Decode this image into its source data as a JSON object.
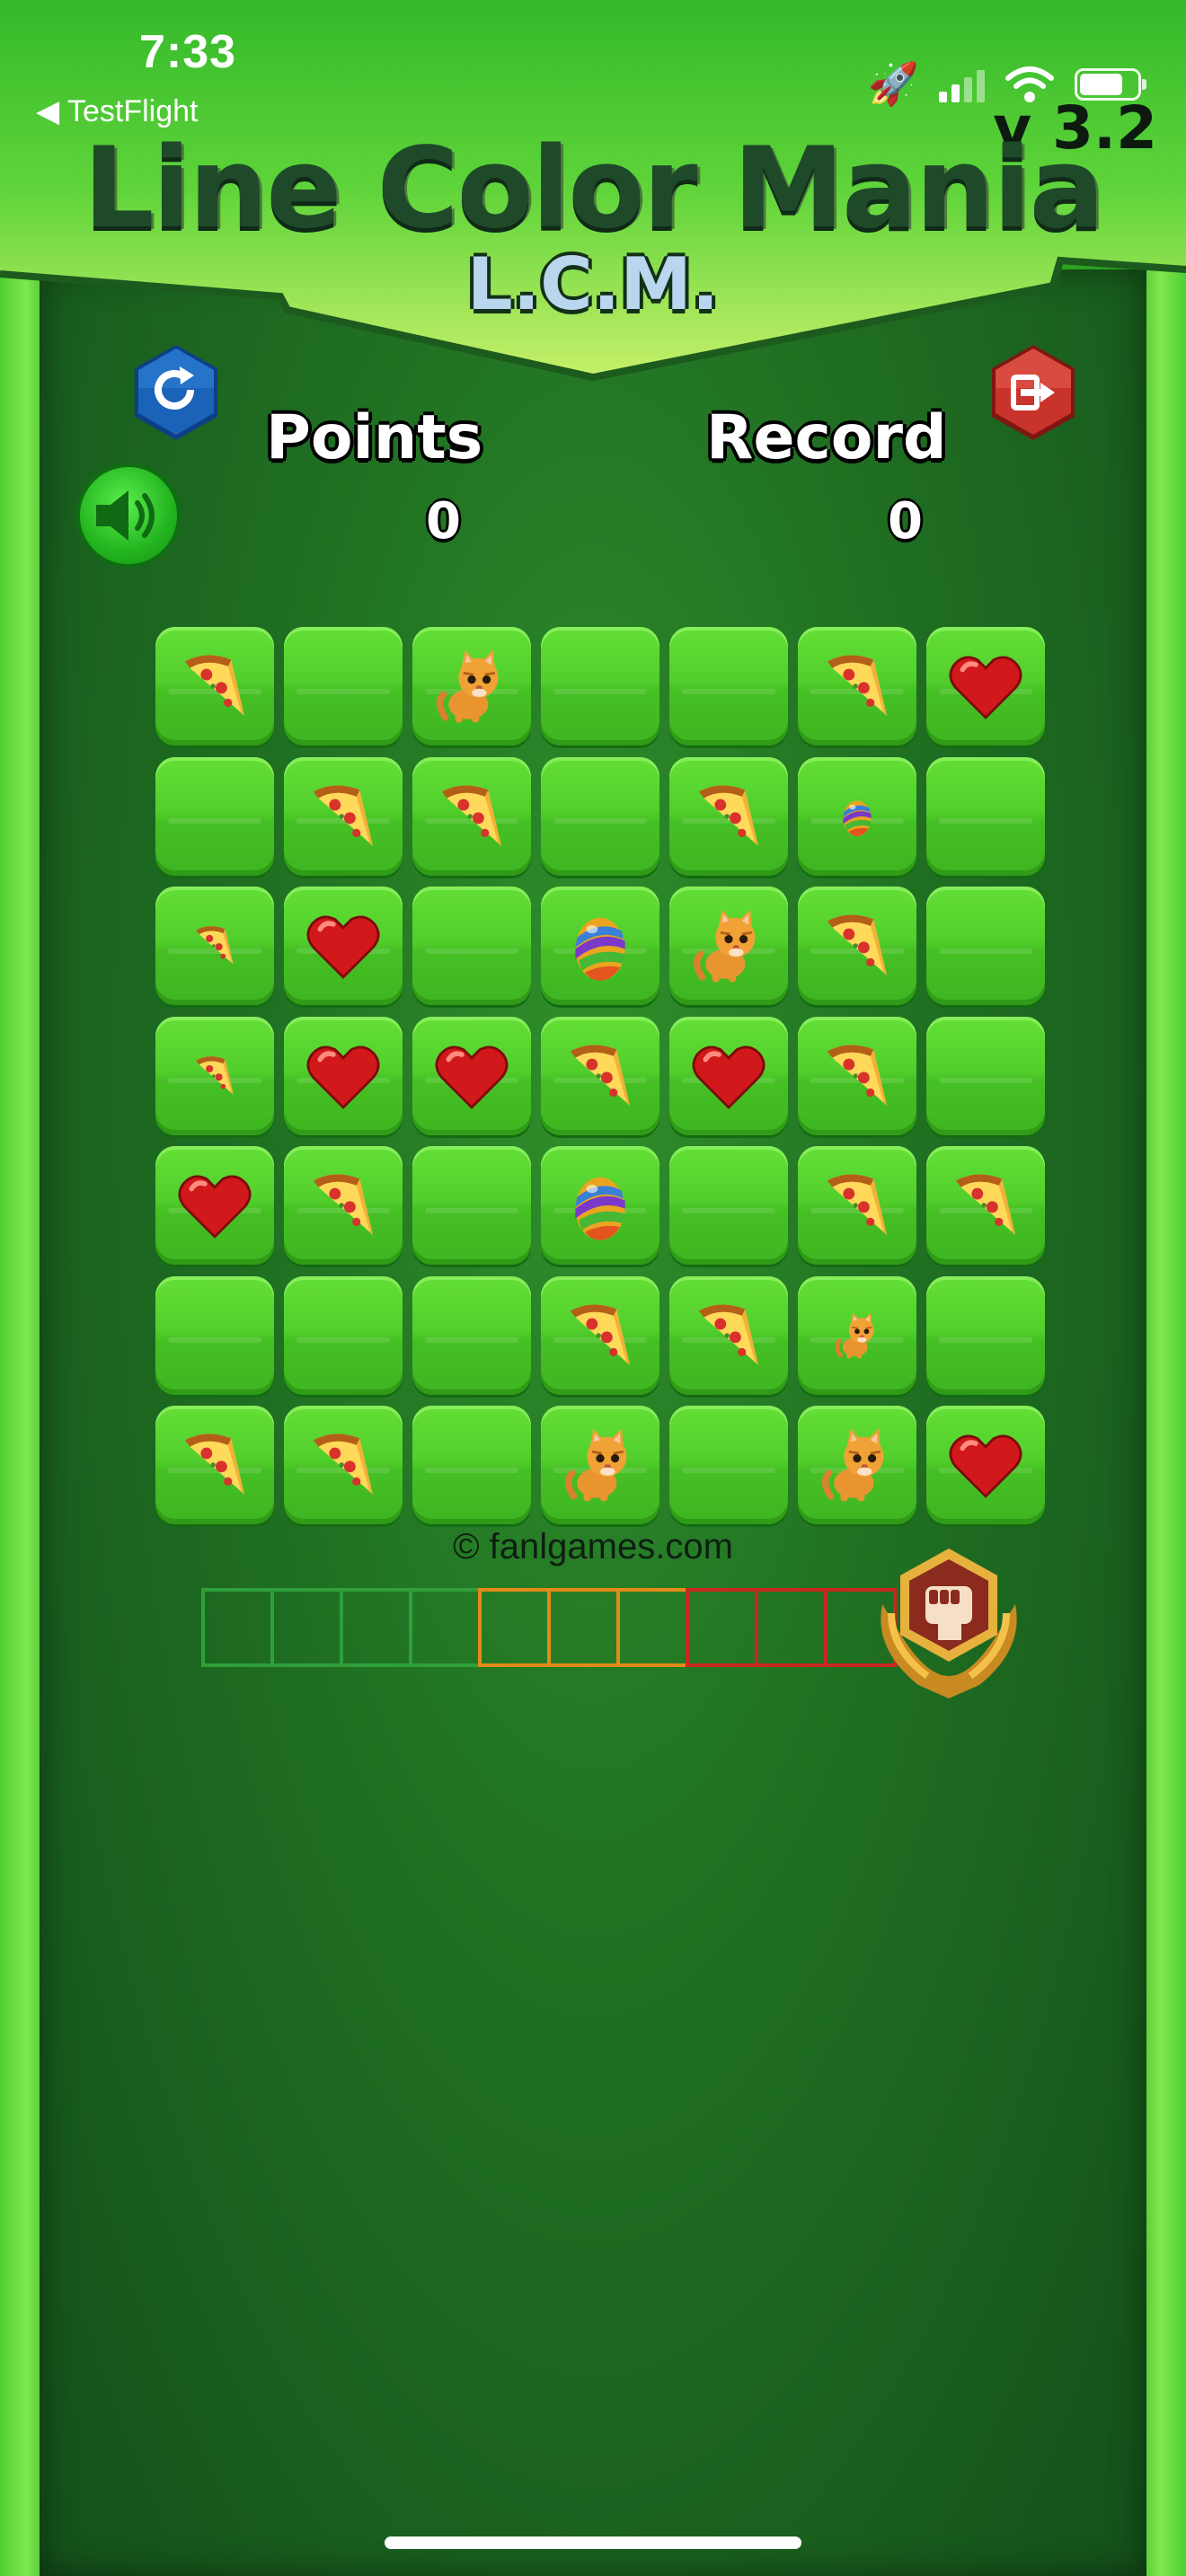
{
  "status_bar": {
    "time": "7:33",
    "back_label": "◀ TestFlight",
    "battery_level": 0.75
  },
  "header": {
    "title": "Line Color Mania",
    "subtitle": "L.C.M.",
    "version": "v 3.2"
  },
  "scores": {
    "points_label": "Points",
    "points_value": "0",
    "record_label": "Record",
    "record_value": "0"
  },
  "buttons": {
    "restart_icon": "refresh-icon",
    "exit_icon": "exit-icon",
    "sound_icon": "speaker-icon"
  },
  "board": {
    "rows": 7,
    "cols": 7,
    "cells": [
      [
        "pizza",
        "empty",
        "cat",
        "empty",
        "empty",
        "pizza",
        "heart"
      ],
      [
        "empty",
        "pizza",
        "pizza",
        "empty",
        "pizza",
        "egg-small",
        "empty"
      ],
      [
        "pizza-small",
        "heart",
        "empty",
        "egg",
        "cat",
        "pizza",
        "empty"
      ],
      [
        "pizza-small",
        "heart",
        "heart",
        "pizza",
        "heart",
        "pizza",
        "empty"
      ],
      [
        "heart",
        "pizza",
        "empty",
        "egg",
        "empty",
        "pizza",
        "pizza"
      ],
      [
        "empty",
        "empty",
        "empty",
        "pizza",
        "pizza",
        "cat-small",
        "empty"
      ],
      [
        "pizza",
        "pizza",
        "empty",
        "cat",
        "empty",
        "cat",
        "heart"
      ]
    ]
  },
  "copyright": "© fanlgames.com",
  "progress": {
    "segments": [
      "green",
      "green",
      "green",
      "green",
      "orange",
      "orange",
      "orange",
      "red",
      "red",
      "red"
    ],
    "filled": 0,
    "badge_icon": "fist-badge-icon"
  },
  "colors": {
    "accent_green": "#45c024",
    "header_title": "#1e4a2a",
    "restart_button": "#1a63b8",
    "exit_button": "#c8332b",
    "badge_gold": "#d79a2b",
    "badge_core": "#8a2b1e"
  }
}
